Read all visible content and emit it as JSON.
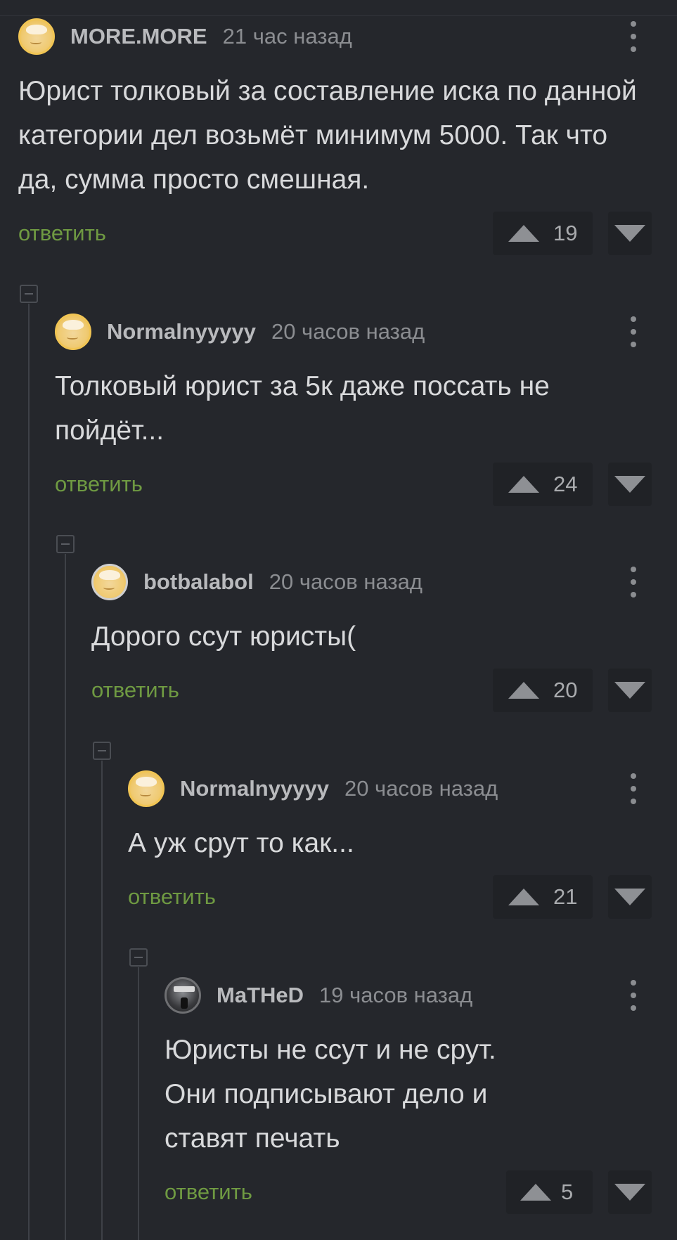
{
  "comments": [
    {
      "author": "MORE.MORE",
      "time": "21 час назад",
      "text": "Юрист толковый за составление иска по данной категории дел возьмёт минимум 5000. Так что да, сумма просто смешная.",
      "reply": "ответить",
      "votes": "19"
    },
    {
      "author": "Normalnyyyyy",
      "time": "20 часов назад",
      "text": "Толковый юрист за 5к даже поссать не пойдёт...",
      "reply": "ответить",
      "votes": "24"
    },
    {
      "author": "botbalabol",
      "time": "20 часов назад",
      "text": "Дорого ссут юристы(",
      "reply": "ответить",
      "votes": "20"
    },
    {
      "author": "Normalnyyyyy",
      "time": "20 часов назад",
      "text": "А уж срут то как...",
      "reply": "ответить",
      "votes": "21"
    },
    {
      "author": "MaTHeD",
      "time": "19 часов назад",
      "text": "Юристы не ссут и не срут. Они подписывают дело и ставят печать",
      "reply": "ответить",
      "votes": "5"
    }
  ],
  "colors": {
    "background": "#25272c",
    "reply": "#6f9a42",
    "text": "#d8d9db"
  },
  "icons": [
    "avatar",
    "more-vertical-icon",
    "upvote-arrow-icon",
    "downvote-arrow-icon",
    "collapse-thread-icon"
  ]
}
